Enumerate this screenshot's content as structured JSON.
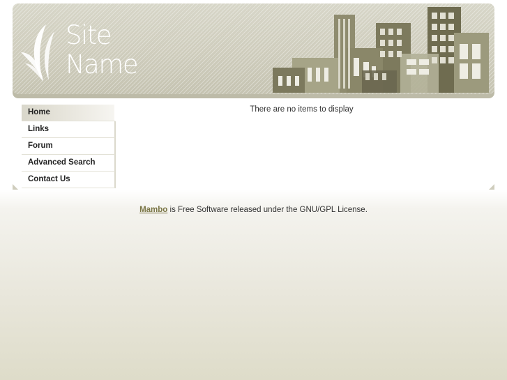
{
  "header": {
    "logo_line1": "Site",
    "logo_line2": "Name"
  },
  "menu": {
    "items": [
      {
        "label": "Home",
        "active": true
      },
      {
        "label": "Links",
        "active": false
      },
      {
        "label": "Forum",
        "active": false
      },
      {
        "label": "Advanced Search",
        "active": false
      },
      {
        "label": "Contact Us",
        "active": false
      }
    ]
  },
  "main": {
    "message": "There are no items to display"
  },
  "footer": {
    "link_label": "Mambo",
    "text": " is Free Software released under the GNU/GPL License."
  },
  "colors": {
    "header_bg": "#cfcdbd",
    "building_dark": "#6e6b50",
    "building_mid": "#8c8a6c",
    "link": "#7a7545"
  }
}
